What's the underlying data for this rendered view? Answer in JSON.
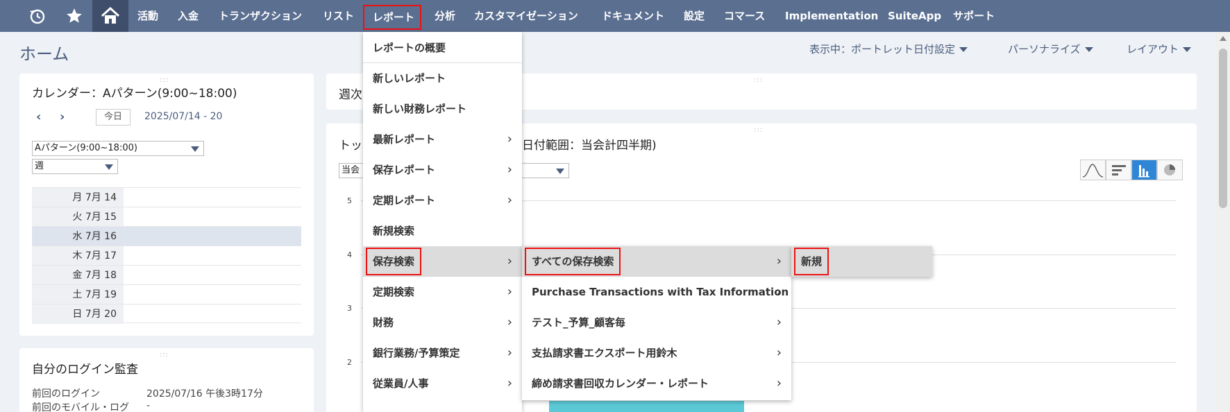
{
  "nav": {
    "items": [
      "活動",
      "入金",
      "トランザクション",
      "リスト",
      "レポート",
      "分析",
      "カスタマイゼーション",
      "ドキュメント",
      "設定",
      "コマース",
      "Implementation",
      "SuiteApp",
      "サポート"
    ]
  },
  "header": {
    "title": "ホーム",
    "view_label": "表示中：ポートレット日付設定",
    "personalize": "パーソナライズ",
    "layout": "レイアウト"
  },
  "calendar": {
    "title": "カレンダー：Aパターン(9:00~18:00)",
    "today": "今日",
    "range": "2025/07/14 - 20",
    "pattern_select": "Aパターン(9:00~18:00)",
    "view_select": "週",
    "days": [
      "月 7月 14",
      "火 7月 15",
      "水 7月 16",
      "木 7月 17",
      "金 7月 18",
      "土 7月 19",
      "日 7月 20"
    ],
    "today_index": 2
  },
  "audit": {
    "title": "自分のログイン監査",
    "last_login_label": "前回のログイン",
    "last_login_value": "2025/07/16 午後3時17分",
    "last_mobile_label": "前回のモバイル・ログ",
    "last_mobile_value": "-"
  },
  "weekly": {
    "title": "週次"
  },
  "chart": {
    "title_left": "トッ",
    "title_right": "日付範囲：当会計四半期)",
    "select_label": "当会",
    "y_ticks": [
      "5",
      "4",
      "3",
      "2"
    ]
  },
  "menu_l1": {
    "items": [
      "レポートの概要",
      "新しいレポート",
      "新しい財務レポート",
      "最新レポート",
      "保存レポート",
      "定期レポート",
      "新規検索",
      "保存検索",
      "定期検索",
      "財務",
      "銀行業務/予算策定",
      "従業員/人事"
    ]
  },
  "menu_l2": {
    "items": [
      "すべての保存検索",
      "Purchase Transactions with Tax Information",
      "テスト_予算_顧客毎",
      "支払請求書エクスポート用鈴木",
      "締め請求書回収カレンダー・レポート"
    ]
  },
  "menu_l3": {
    "items": [
      "新規"
    ]
  },
  "colors": {
    "nav": "#5b6f91",
    "nav_home": "#3e4e6b",
    "highlight_border": "#e11",
    "chart_bar": "#5bc8d6"
  }
}
